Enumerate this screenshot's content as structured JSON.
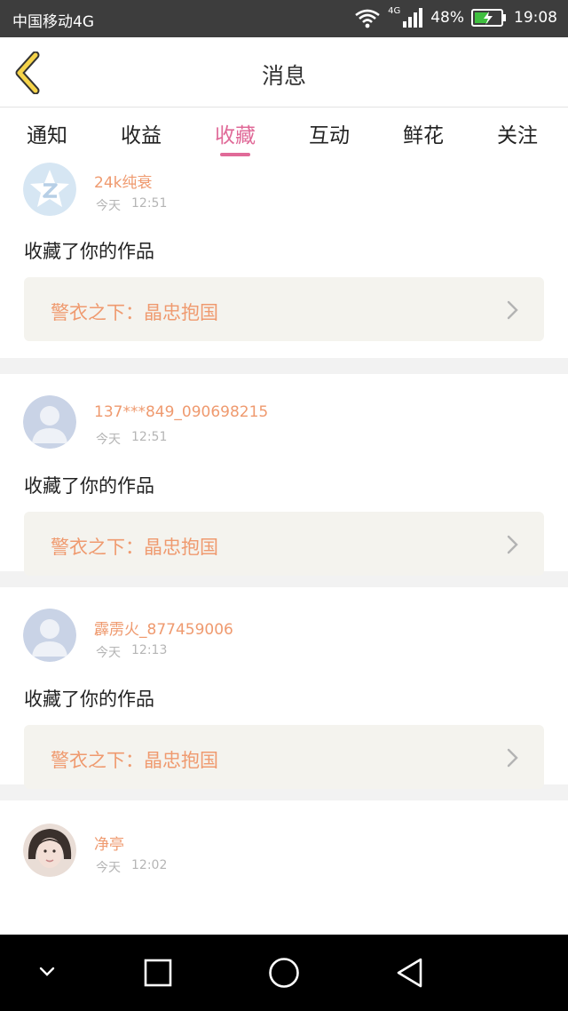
{
  "status_bar": {
    "carrier": "中国移动4G",
    "network": "4G",
    "battery": "48%",
    "time": "19:08",
    "icons": [
      "wifi-icon",
      "signal-icon",
      "battery-icon"
    ]
  },
  "header": {
    "title": "消息",
    "back_icon": "back-arrow-icon"
  },
  "tabs": {
    "items": [
      {
        "label": "通知"
      },
      {
        "label": "收益"
      },
      {
        "label": "收藏"
      },
      {
        "label": "互动"
      },
      {
        "label": "鲜花"
      },
      {
        "label": "关注"
      }
    ],
    "active_index": 2
  },
  "feed": {
    "items": [
      {
        "username": "24k纯衰",
        "day": "今天",
        "time": "12:51",
        "action": "收藏了你的作品",
        "work_title": "警衣之下：晶忠抱国",
        "avatar": "qzone-avatar"
      },
      {
        "username": "137***849_090698215",
        "day": "今天",
        "time": "12:51",
        "action": "收藏了你的作品",
        "work_title": "警衣之下：晶忠抱国",
        "avatar": "default-avatar"
      },
      {
        "username": "霹雳火_877459006",
        "day": "今天",
        "time": "12:13",
        "action": "收藏了你的作品",
        "work_title": "警衣之下：晶忠抱国",
        "avatar": "default-avatar"
      },
      {
        "username": "净亭",
        "day": "今天",
        "time": "12:02",
        "avatar": "photo-avatar"
      }
    ]
  },
  "colors": {
    "accent": "#e06a98",
    "username": "#ef9a6f",
    "work_box_bg": "#f4f3ee",
    "status_bar_bg": "#3d3d3d",
    "nav_bar_bg": "#000000",
    "back_arrow_fill": "#f6d44a"
  },
  "nav_bar": {
    "icons": [
      "chevron-down-icon",
      "recents-icon",
      "home-icon",
      "back-triangle-icon"
    ]
  }
}
